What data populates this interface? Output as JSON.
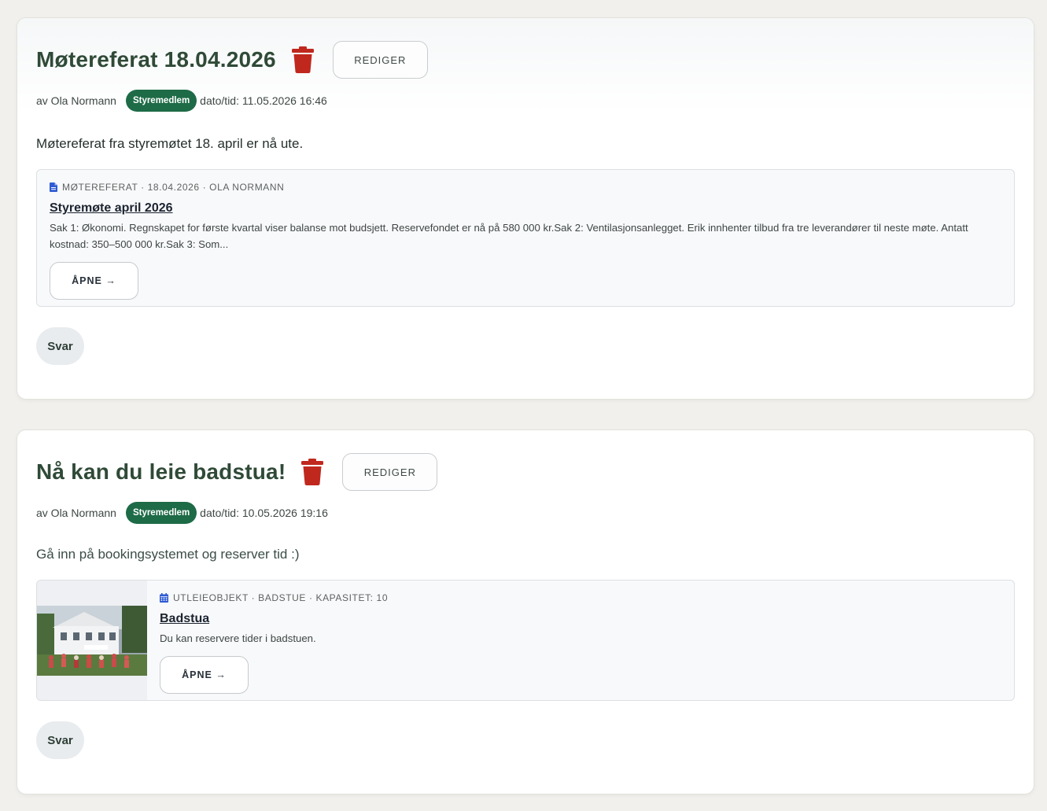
{
  "posts": [
    {
      "title": "Møtereferat 18.04.2026",
      "edit_label": "REDIGER",
      "author": "av Ola Normann",
      "role_badge": "Styremedlem",
      "datetime": "dato/tid: 11.05.2026 16:46",
      "body": "Møtereferat fra styremøtet 18. april er nå ute.",
      "attachment": {
        "icon": "document-icon",
        "kicker": "MØTEREFERAT · 18.04.2026 · OLA NORMANN",
        "title": "Styremøte april 2026",
        "description": "Sak 1: Økonomi. Regnskapet for første kvartal viser balanse mot budsjett. Reservefondet er nå på 580 000 kr.Sak 2: Ventilasjonsanlegget. Erik innhenter tilbud fra tre leverandører til neste møte. Antatt kostnad: 350–500 000 kr.Sak 3: Som...",
        "open_label": "ÅPNE →"
      },
      "reply_label": "Svar"
    },
    {
      "title": "Nå kan du leie badstua!",
      "edit_label": "REDIGER",
      "author": "av Ola Normann",
      "role_badge": "Styremedlem",
      "datetime": "dato/tid: 10.05.2026 19:16",
      "body": "Gå inn på bookingsystemet og reserver tid :)",
      "attachment": {
        "icon": "calendar-icon",
        "kicker": "UTLEIEOBJEKT · BADSTUE · KAPASITET: 10",
        "title": "Badstua",
        "description": "Du kan reservere tider i badstuen.",
        "open_label": "ÅPNE →"
      },
      "reply_label": "Svar"
    }
  ],
  "colors": {
    "title": "#2f4a37",
    "badge": "#1e6b47",
    "trash": "#c0281e",
    "kicker_icon": "#2f5bd3",
    "page_bg": "#f1f0ec"
  }
}
